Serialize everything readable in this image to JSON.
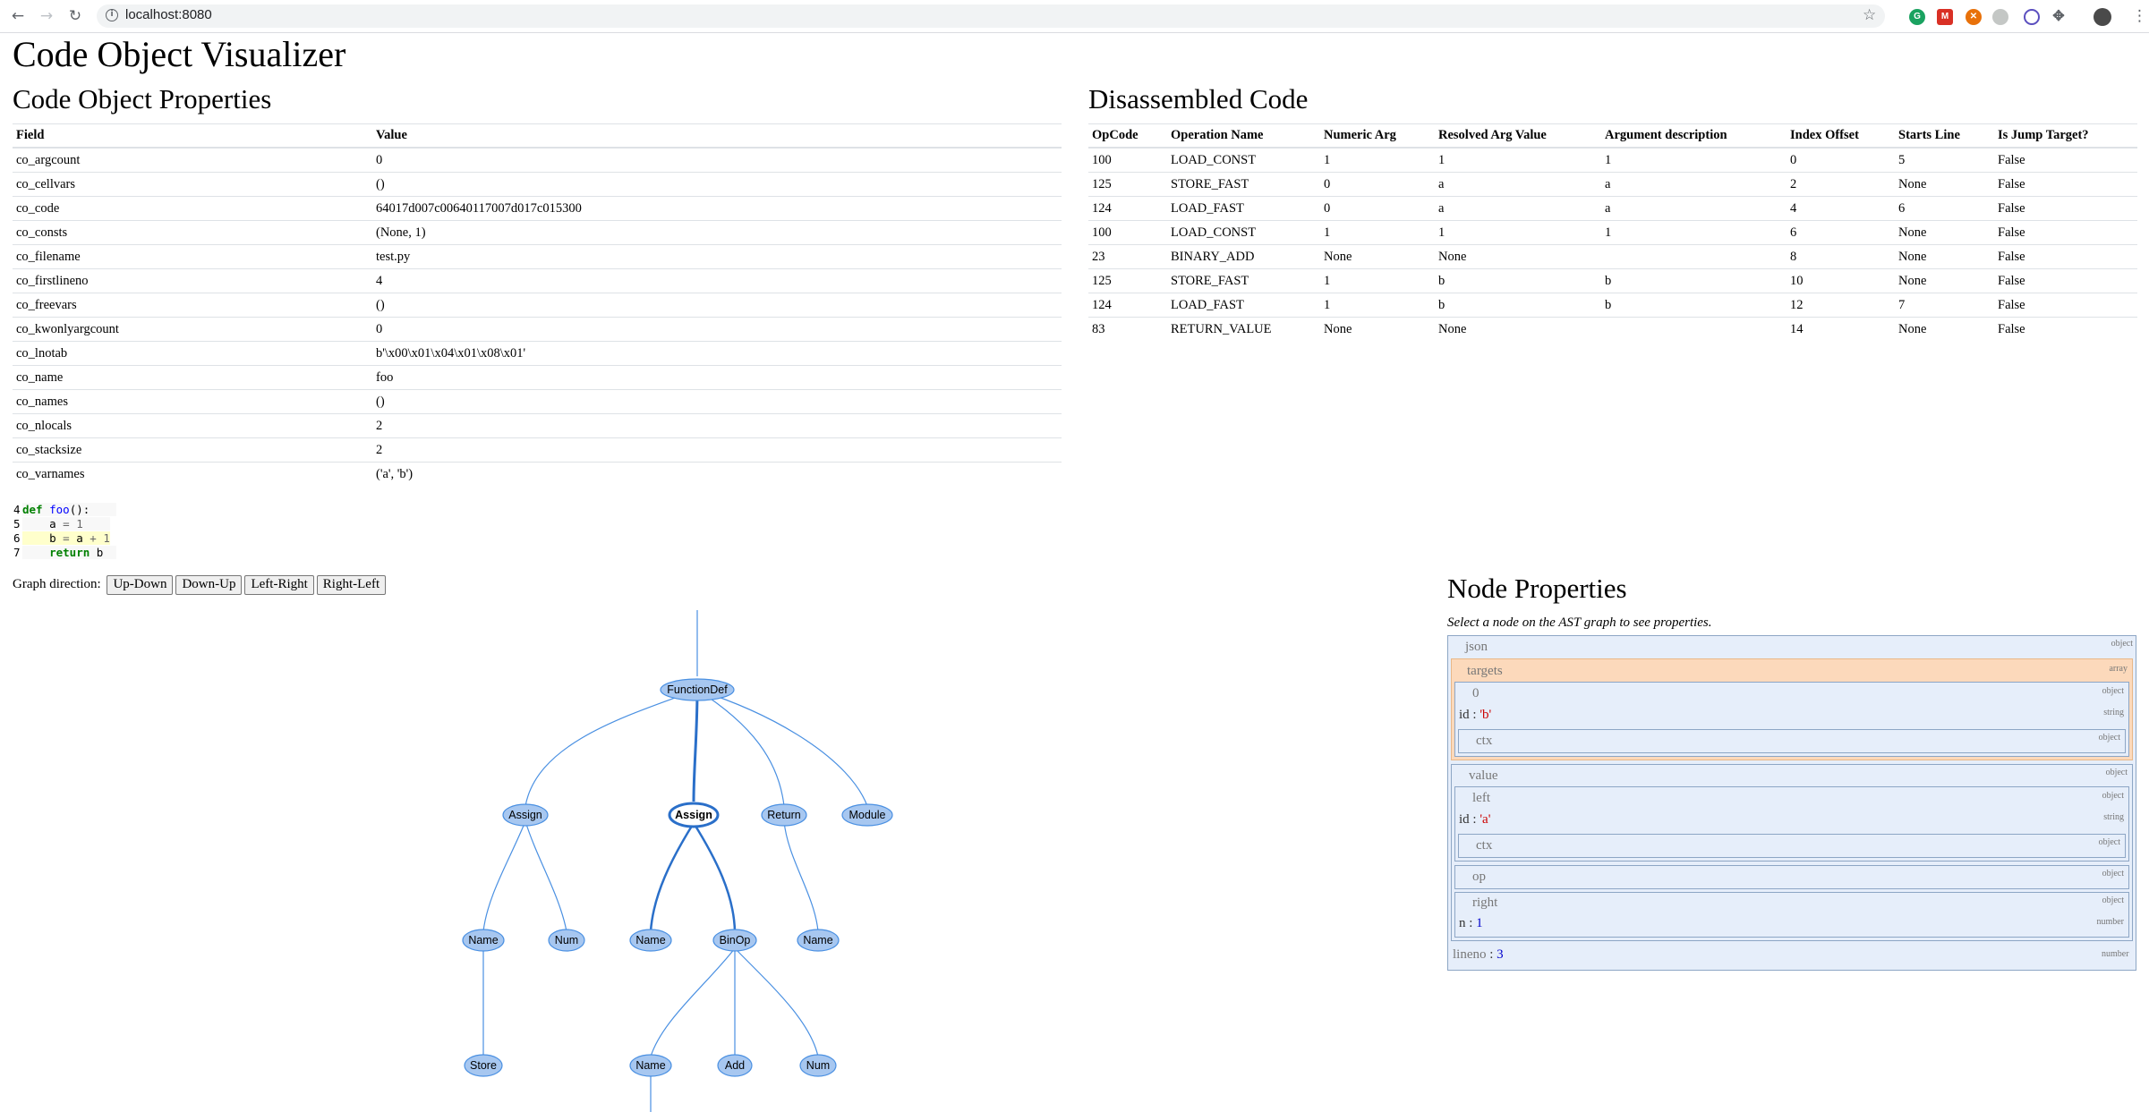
{
  "browser": {
    "url": "localhost:8080",
    "back_icon": "arrow-left",
    "forward_icon": "arrow-right",
    "reload_icon": "reload",
    "extension_colors": [
      "#1aa260",
      "#d93025",
      "#e8710a",
      "#9aa0a6",
      "#5b4fbf",
      "#5f6368"
    ]
  },
  "page": {
    "title": "Code Object Visualizer"
  },
  "code_props": {
    "title": "Code Object Properties",
    "headers": [
      "Field",
      "Value"
    ],
    "rows": [
      [
        "co_argcount",
        "0"
      ],
      [
        "co_cellvars",
        "()"
      ],
      [
        "co_code",
        "64017d007c00640117007d017c015300"
      ],
      [
        "co_consts",
        "(None, 1)"
      ],
      [
        "co_filename",
        "test.py"
      ],
      [
        "co_firstlineno",
        "4"
      ],
      [
        "co_freevars",
        "()"
      ],
      [
        "co_kwonlyargcount",
        "0"
      ],
      [
        "co_lnotab",
        "b'\\x00\\x01\\x04\\x01\\x08\\x01'"
      ],
      [
        "co_name",
        "foo"
      ],
      [
        "co_names",
        "()"
      ],
      [
        "co_nlocals",
        "2"
      ],
      [
        "co_stacksize",
        "2"
      ],
      [
        "co_varnames",
        "('a', 'b')"
      ]
    ]
  },
  "disasm": {
    "title": "Disassembled Code",
    "headers": [
      "OpCode",
      "Operation Name",
      "Numeric Arg",
      "Resolved Arg Value",
      "Argument description",
      "Index Offset",
      "Starts Line",
      "Is Jump Target?"
    ],
    "rows": [
      [
        "100",
        "LOAD_CONST",
        "1",
        "1",
        "1",
        "0",
        "5",
        "False"
      ],
      [
        "125",
        "STORE_FAST",
        "0",
        "a",
        "a",
        "2",
        "None",
        "False"
      ],
      [
        "124",
        "LOAD_FAST",
        "0",
        "a",
        "a",
        "4",
        "6",
        "False"
      ],
      [
        "100",
        "LOAD_CONST",
        "1",
        "1",
        "1",
        "6",
        "None",
        "False"
      ],
      [
        "23",
        "BINARY_ADD",
        "None",
        "None",
        "",
        "8",
        "None",
        "False"
      ],
      [
        "125",
        "STORE_FAST",
        "1",
        "b",
        "b",
        "10",
        "None",
        "False"
      ],
      [
        "124",
        "LOAD_FAST",
        "1",
        "b",
        "b",
        "12",
        "7",
        "False"
      ],
      [
        "83",
        "RETURN_VALUE",
        "None",
        "None",
        "",
        "14",
        "None",
        "False"
      ]
    ]
  },
  "source": {
    "line_numbers": [
      "4",
      "5",
      "6",
      "7"
    ],
    "l4": {
      "kw": "def",
      "fn": "foo",
      "rest": "():"
    },
    "l5": {
      "var": "a",
      "eq": "=",
      "val": "1"
    },
    "l6": {
      "var": "b",
      "eq": "=",
      "a": "a",
      "plus": "+",
      "val": "1"
    },
    "l7": {
      "kw": "return",
      "var": "b"
    }
  },
  "graph_controls": {
    "label": "Graph direction:",
    "buttons": [
      "Up-Down",
      "Down-Up",
      "Left-Right",
      "Right-Left"
    ]
  },
  "ast_nodes": {
    "functiondef": "FunctionDef",
    "assign1": "Assign",
    "assign2": "Assign",
    "return": "Return",
    "module": "Module",
    "name1": "Name",
    "num1": "Num",
    "name2": "Name",
    "binop": "BinOp",
    "name3": "Name",
    "store": "Store",
    "name4": "Name",
    "add": "Add",
    "num2": "Num"
  },
  "node_props": {
    "title": "Node Properties",
    "subtitle": "Select a node on the AST graph to see properties.",
    "json_key": "json",
    "object_type": "object",
    "array_type": "array",
    "string_type": "string",
    "number_type": "number",
    "targets_key": "targets",
    "index0": "0",
    "id_key": "id",
    "id_b": "'b'",
    "ctx_key": "ctx",
    "value_key": "value",
    "left_key": "left",
    "id_a": "'a'",
    "op_key": "op",
    "right_key": "right",
    "n_key": "n",
    "n_val": "1",
    "lineno_key": "lineno",
    "lineno_val": "3"
  }
}
